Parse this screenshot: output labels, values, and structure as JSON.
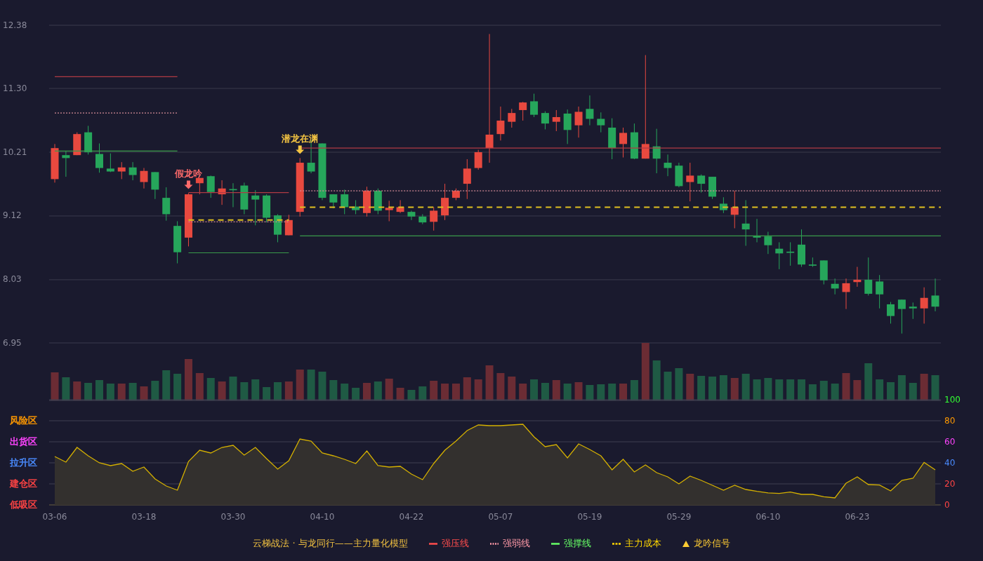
{
  "price_chart": {
    "chart_data": {
      "type": "candlestick",
      "grid": true,
      "ylim": [
        6.95,
        12.38
      ],
      "ref_lines": [
        {
          "axis": "y",
          "value": 11.5,
          "color": "#b03a44"
        },
        {
          "axis": "y",
          "value": 10.88,
          "color": "#d48a96"
        },
        {
          "axis": "y",
          "value": 10.23,
          "color": "#3a9a4a"
        },
        {
          "axis": "y",
          "value": 9.52,
          "color": "#b03a44"
        },
        {
          "axis": "y",
          "value": 9.02,
          "color": "#d48a96"
        },
        {
          "axis": "y",
          "value": 9.05,
          "color": "#e0c020"
        },
        {
          "axis": "y",
          "value": 8.49,
          "color": "#3a9a4a"
        },
        {
          "axis": "y",
          "value": 10.28,
          "color": "#b03a44"
        },
        {
          "axis": "y",
          "value": 9.55,
          "color": "#d48a96"
        },
        {
          "axis": "y",
          "value": 9.27,
          "color": "#e0c020"
        },
        {
          "axis": "y",
          "value": 8.78,
          "color": "#3a9a4a"
        }
      ],
      "yticks": [
        {
          "value": 12.38,
          "label": "12.38"
        },
        {
          "value": 11.3,
          "label": "11.30"
        },
        {
          "value": 10.21,
          "label": "10.21"
        },
        {
          "value": 9.12,
          "label": "9.12"
        },
        {
          "value": 8.03,
          "label": "8.03"
        },
        {
          "value": 6.95,
          "label": "6.95"
        }
      ],
      "ohlc": [
        [
          9.75,
          10.35,
          9.69,
          10.28
        ],
        [
          10.16,
          10.23,
          9.79,
          10.11
        ],
        [
          10.16,
          10.55,
          10.16,
          10.52
        ],
        [
          10.55,
          10.66,
          10.17,
          10.21
        ],
        [
          10.18,
          10.36,
          9.86,
          9.94
        ],
        [
          9.93,
          10.19,
          9.87,
          9.88
        ],
        [
          9.88,
          10.04,
          9.75,
          9.95
        ],
        [
          9.95,
          10.04,
          9.73,
          9.82
        ],
        [
          9.7,
          9.94,
          9.59,
          9.89
        ],
        [
          9.87,
          9.87,
          9.41,
          9.57
        ],
        [
          9.43,
          9.61,
          9.04,
          9.15
        ],
        [
          8.95,
          9.03,
          8.31,
          8.5
        ],
        [
          8.75,
          9.51,
          8.6,
          9.49
        ],
        [
          9.68,
          9.77,
          9.49,
          9.77
        ],
        [
          9.8,
          9.81,
          9.43,
          9.53
        ],
        [
          9.49,
          9.73,
          9.31,
          9.59
        ],
        [
          9.58,
          9.68,
          9.27,
          9.56
        ],
        [
          9.64,
          9.69,
          9.15,
          9.23
        ],
        [
          9.47,
          9.56,
          8.96,
          9.4
        ],
        [
          9.47,
          9.49,
          9.01,
          9.09
        ],
        [
          9.13,
          9.15,
          8.67,
          8.8
        ],
        [
          8.79,
          9.14,
          8.79,
          9.05
        ],
        [
          9.19,
          10.11,
          9.11,
          10.03
        ],
        [
          10.03,
          10.42,
          9.85,
          9.88
        ],
        [
          10.36,
          10.36,
          9.39,
          9.43
        ],
        [
          9.49,
          9.49,
          9.25,
          9.35
        ],
        [
          9.49,
          9.57,
          9.15,
          9.27
        ],
        [
          9.28,
          9.39,
          9.15,
          9.22
        ],
        [
          9.17,
          9.62,
          9.11,
          9.55
        ],
        [
          9.55,
          9.59,
          9.15,
          9.21
        ],
        [
          9.22,
          9.38,
          9.03,
          9.26
        ],
        [
          9.19,
          9.39,
          9.17,
          9.27
        ],
        [
          9.19,
          9.21,
          9.05,
          9.11
        ],
        [
          9.11,
          9.15,
          8.98,
          9.01
        ],
        [
          9.02,
          9.27,
          8.87,
          9.21
        ],
        [
          9.13,
          9.67,
          9.05,
          9.43
        ],
        [
          9.43,
          9.59,
          9.39,
          9.55
        ],
        [
          9.67,
          10.09,
          9.41,
          9.93
        ],
        [
          9.94,
          10.25,
          9.91,
          10.21
        ],
        [
          10.28,
          12.23,
          10.03,
          10.51
        ],
        [
          10.52,
          10.99,
          10.41,
          10.75
        ],
        [
          10.73,
          10.95,
          10.63,
          10.88
        ],
        [
          10.93,
          11.07,
          10.75,
          11.06
        ],
        [
          11.08,
          11.21,
          10.81,
          10.85
        ],
        [
          10.88,
          10.91,
          10.6,
          10.7
        ],
        [
          10.73,
          10.93,
          10.57,
          10.81
        ],
        [
          10.87,
          10.94,
          10.35,
          10.59
        ],
        [
          10.67,
          10.99,
          10.46,
          10.9
        ],
        [
          10.95,
          11.18,
          10.67,
          10.78
        ],
        [
          10.78,
          10.89,
          10.55,
          10.67
        ],
        [
          10.63,
          10.79,
          10.09,
          10.28
        ],
        [
          10.35,
          10.63,
          10.12,
          10.54
        ],
        [
          10.55,
          10.7,
          10.09,
          10.1
        ],
        [
          10.1,
          11.87,
          10.1,
          10.35
        ],
        [
          10.31,
          10.61,
          9.85,
          10.1
        ],
        [
          10.03,
          10.17,
          9.8,
          9.94
        ],
        [
          9.98,
          10.03,
          9.61,
          9.63
        ],
        [
          9.7,
          10.03,
          9.37,
          9.81
        ],
        [
          9.81,
          9.83,
          9.52,
          9.67
        ],
        [
          9.79,
          9.79,
          9.41,
          9.45
        ],
        [
          9.33,
          9.44,
          9.17,
          9.22
        ],
        [
          9.14,
          9.55,
          8.91,
          9.27
        ],
        [
          8.99,
          9.39,
          8.61,
          8.89
        ],
        [
          8.78,
          9.07,
          8.67,
          8.75
        ],
        [
          8.77,
          8.85,
          8.47,
          8.62
        ],
        [
          8.56,
          8.67,
          8.21,
          8.48
        ],
        [
          8.51,
          8.67,
          8.27,
          8.49
        ],
        [
          8.63,
          8.89,
          8.25,
          8.29
        ],
        [
          8.29,
          8.41,
          8.25,
          8.27
        ],
        [
          8.36,
          8.36,
          7.95,
          8.02
        ],
        [
          7.96,
          8.05,
          7.78,
          7.88
        ],
        [
          7.82,
          8.05,
          7.53,
          7.97
        ],
        [
          7.99,
          8.25,
          7.91,
          8.03
        ],
        [
          8.03,
          8.41,
          7.76,
          7.79
        ],
        [
          8.0,
          8.11,
          7.54,
          7.78
        ],
        [
          7.61,
          7.65,
          7.28,
          7.41
        ],
        [
          7.69,
          7.69,
          7.11,
          7.53
        ],
        [
          7.57,
          7.64,
          7.36,
          7.54
        ],
        [
          7.54,
          7.9,
          7.28,
          7.72
        ],
        [
          7.76,
          8.05,
          7.49,
          7.57
        ]
      ]
    },
    "signals": [
      {
        "label": "假龙吟",
        "color": "#ff6b6b"
      },
      {
        "label": "潜龙在渊",
        "color": "#f5c542"
      }
    ]
  },
  "oscillator": {
    "zone_labels": [
      {
        "label": "风险区",
        "color": "#ff9900"
      },
      {
        "label": "出货区",
        "color": "#ff44ff"
      },
      {
        "label": "拉升区",
        "color": "#4a8cff"
      },
      {
        "label": "建仓区",
        "color": "#ff4444"
      },
      {
        "label": "低吸区",
        "color": "#ff4444"
      }
    ],
    "axis_labels": [
      {
        "label": "100",
        "color": "#33ff33"
      },
      {
        "label": "80",
        "color": "#ff9900"
      },
      {
        "label": "60",
        "color": "#ff44ff"
      },
      {
        "label": "40",
        "color": "#4a8cff"
      },
      {
        "label": "20",
        "color": "#ff4444"
      },
      {
        "label": "0",
        "color": "#ff4444"
      }
    ],
    "chart_data": {
      "type": "area",
      "grid": true,
      "categories": [
        "03-06",
        null,
        null,
        null,
        null,
        null,
        null,
        null,
        "03-18",
        null,
        null,
        null,
        null,
        null,
        null,
        null,
        "03-30",
        null,
        null,
        null,
        null,
        null,
        null,
        null,
        "04-10",
        null,
        null,
        null,
        null,
        null,
        null,
        null,
        "04-22",
        null,
        null,
        null,
        null,
        null,
        null,
        null,
        "05-07",
        null,
        null,
        null,
        null,
        null,
        null,
        null,
        "05-19",
        null,
        null,
        null,
        null,
        null,
        null,
        null,
        "05-29",
        null,
        null,
        null,
        null,
        null,
        null,
        null,
        "06-10",
        null,
        null,
        null,
        null,
        null,
        null,
        null,
        "06-23",
        null,
        null,
        null,
        null,
        null,
        null,
        null
      ],
      "ylim": [
        0,
        100
      ],
      "yticks": [
        100,
        80,
        60,
        40,
        20,
        0
      ],
      "series": [
        {
          "color": "#d4b000",
          "values": [
            46,
            40.7,
            54.7,
            46.7,
            40,
            37.3,
            39.3,
            32,
            36,
            24.7,
            18,
            14,
            41.3,
            52,
            49.3,
            54.7,
            56.7,
            47.3,
            54.7,
            44,
            34,
            42,
            62.7,
            60.7,
            49.3,
            46.7,
            43.3,
            39.3,
            51.3,
            37.3,
            36,
            36.7,
            29.3,
            24,
            39.3,
            52,
            60.7,
            70.7,
            76,
            75.3,
            75.3,
            76,
            76.7,
            64.7,
            55.3,
            57.3,
            44.7,
            58,
            52.7,
            46.7,
            33.3,
            43.3,
            31.3,
            38,
            30.7,
            26.7,
            20,
            27.3,
            23.3,
            18.7,
            14,
            18.7,
            14.7,
            12.9,
            11.5,
            10.9,
            12.2,
            10,
            10,
            7.8,
            6.7,
            20.7,
            26.7,
            19.3,
            18.9,
            13.3,
            23.3,
            25.3,
            40.4,
            33.3
          ]
        }
      ]
    }
  },
  "legend": {
    "title": "云梯战法 · 与龙同行——主力量化模型",
    "items": [
      {
        "label": "强压线",
        "kind": "solid",
        "color": "#ff4d4d"
      },
      {
        "label": "强弱线",
        "kind": "dotted",
        "color": "#ff9aa8"
      },
      {
        "label": "强撑线",
        "kind": "solid",
        "color": "#66ff66"
      },
      {
        "label": "主力成本",
        "kind": "dashed",
        "color": "#ffd700"
      },
      {
        "label": "龙吟信号",
        "kind": "triangle",
        "color": "#ffcc33"
      }
    ]
  }
}
